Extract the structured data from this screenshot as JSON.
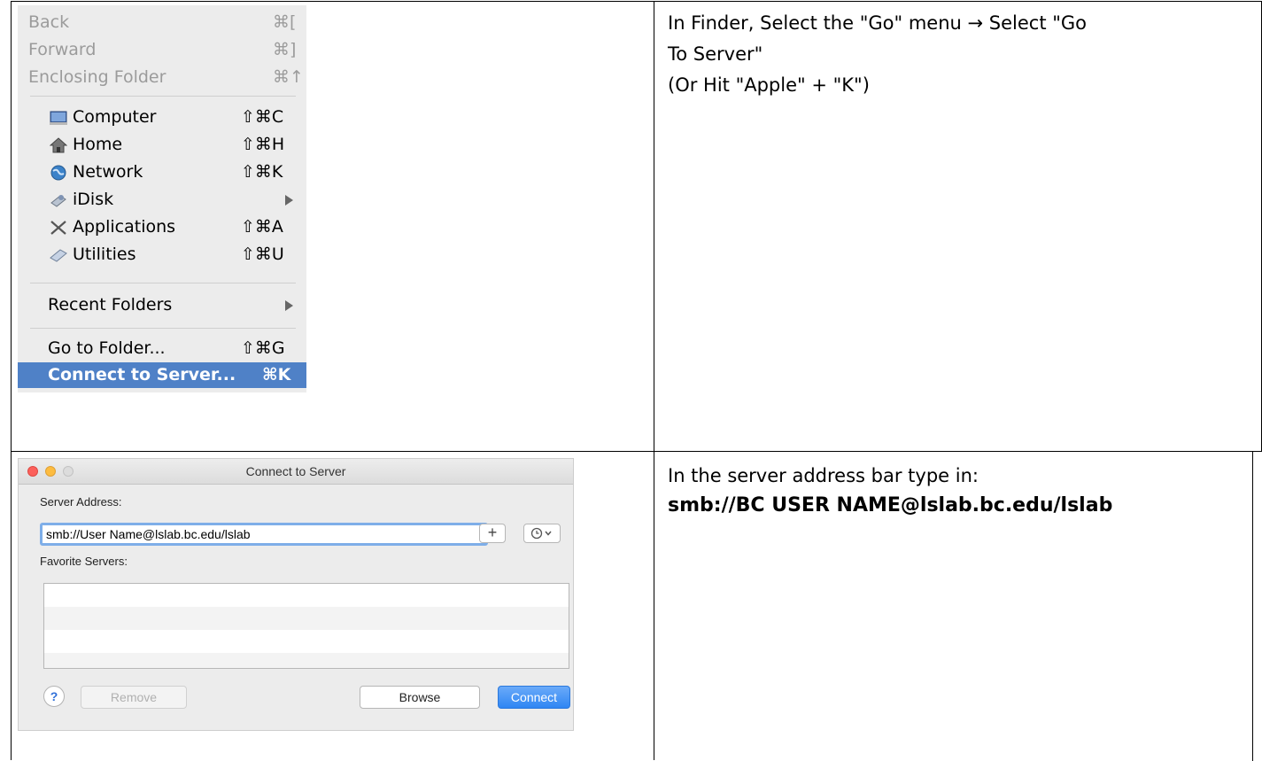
{
  "go_menu": {
    "items": [
      {
        "label": "Back",
        "shortcut": "⌘[",
        "disabled": true
      },
      {
        "label": "Forward",
        "shortcut": "⌘]",
        "disabled": true
      },
      {
        "label": "Enclosing Folder",
        "shortcut": "⌘↑",
        "disabled": true
      },
      {
        "label": "Computer",
        "shortcut": "⇧⌘C",
        "icon": "computer-icon"
      },
      {
        "label": "Home",
        "shortcut": "⇧⌘H",
        "icon": "home-icon"
      },
      {
        "label": "Network",
        "shortcut": "⇧⌘K",
        "icon": "network-icon"
      },
      {
        "label": "iDisk",
        "submenu": true,
        "icon": "idisk-icon"
      },
      {
        "label": "Applications",
        "shortcut": "⇧⌘A",
        "icon": "applications-icon"
      },
      {
        "label": "Utilities",
        "shortcut": "⇧⌘U",
        "icon": "utilities-icon"
      },
      {
        "label": "Recent Folders",
        "submenu": true
      },
      {
        "label": "Go to Folder...",
        "shortcut": "⇧⌘G"
      },
      {
        "label": "Connect to Server...",
        "shortcut": "⌘K",
        "highlighted": true
      }
    ]
  },
  "step1_text": {
    "line1": "In Finder, Select the \"Go\" menu → Select \"Go",
    "line2": "To Server\"",
    "line3": "(Or Hit \"Apple\" + \"K\")"
  },
  "dialog": {
    "title": "Connect to Server",
    "server_address_label": "Server Address:",
    "server_address_value": "smb://User Name@lslab.bc.edu/lslab",
    "add_button": "+",
    "favorites_label": "Favorite Servers:",
    "help_button": "?",
    "remove_button": "Remove",
    "browse_button": "Browse",
    "connect_button": "Connect"
  },
  "step2_text": {
    "line1": "In the server address bar type in:",
    "line2": "smb://BC USER NAME@lslab.bc.edu/lslab"
  },
  "colors": {
    "menu_highlight": "#4f81c7",
    "connect_button": "#3a8ff7",
    "close_light": "#fc605b",
    "minimize_light": "#fdbc40"
  }
}
